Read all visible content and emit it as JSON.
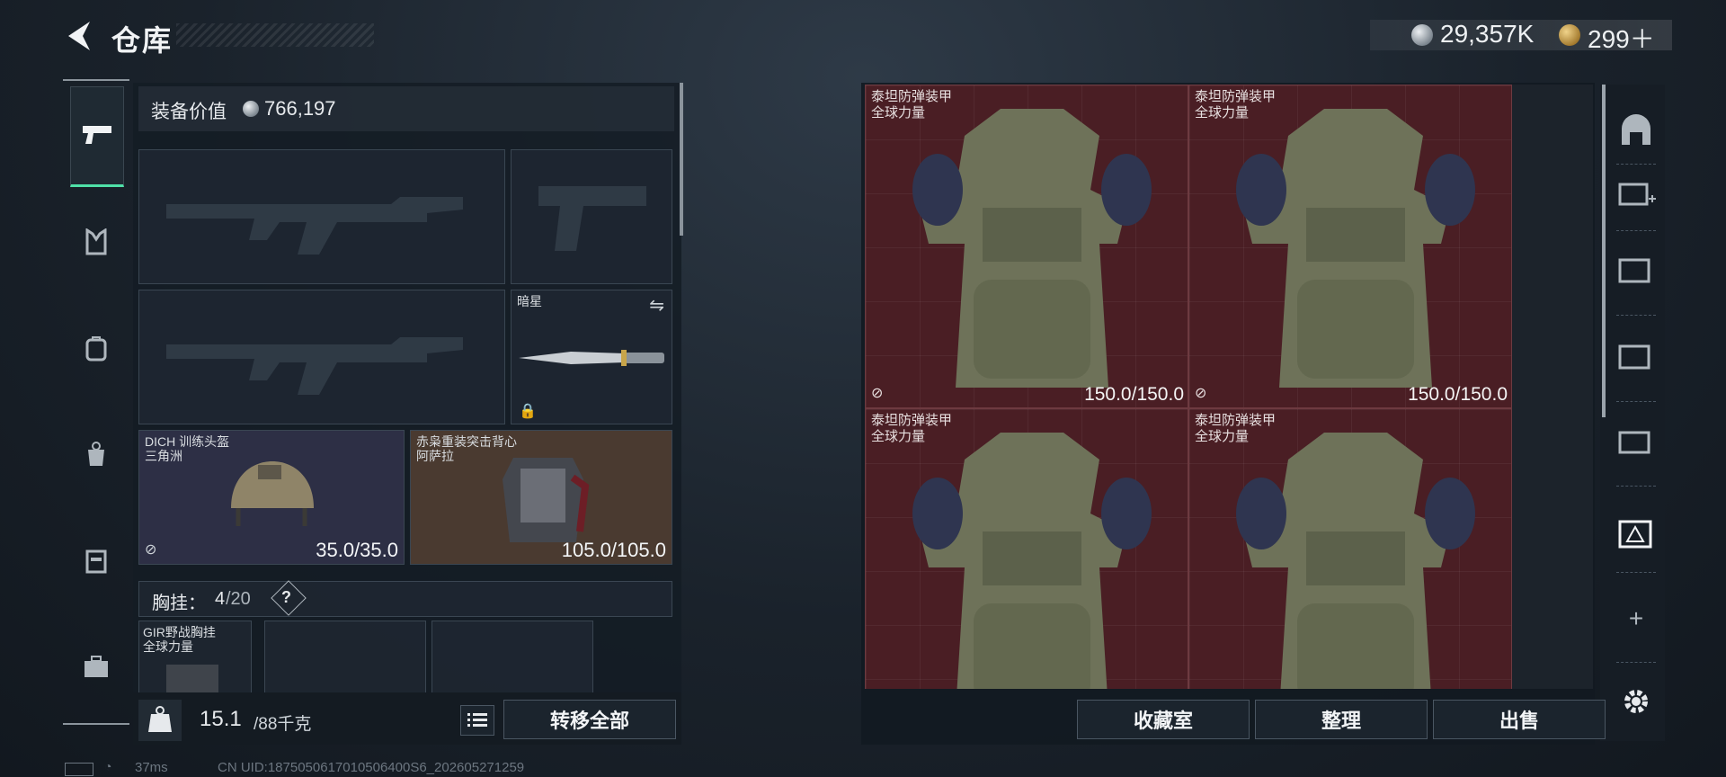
{
  "header": {
    "title": "仓库"
  },
  "currency": {
    "silver": "29,357K",
    "gold": "299＋"
  },
  "left_rail": [
    "pistol-icon",
    "vest-icon",
    "backpack-icon",
    "bag-icon",
    "case-icon",
    "toolbox-icon"
  ],
  "loadout": {
    "value_label": "装备价值",
    "value": "766,197",
    "melee": {
      "name": "暗星"
    },
    "helmet": {
      "name": "DICH 训练头盔",
      "maker": "三角洲",
      "durability": "35.0/35.0"
    },
    "armor": {
      "name": "赤枭重装突击背心",
      "maker": "阿萨拉",
      "durability": "105.0/105.0"
    },
    "chest_rig": {
      "label": "胸挂：",
      "count": "4",
      "capacity": "/20",
      "help": "?"
    },
    "rig_item": {
      "name": "GIR野战胸挂",
      "maker": "全球力量"
    },
    "weight": {
      "current": "15.1",
      "max": "/88千克"
    },
    "transfer_all": "转移全部"
  },
  "storage": {
    "items": [
      {
        "name": "泰坦防弹装甲",
        "maker": "全球力量",
        "durability": "150.0/150.0"
      },
      {
        "name": "泰坦防弹装甲",
        "maker": "全球力量",
        "durability": "150.0/150.0"
      },
      {
        "name": "泰坦防弹装甲",
        "maker": "全球力量",
        "durability": ""
      },
      {
        "name": "泰坦防弹装甲",
        "maker": "全球力量",
        "durability": ""
      }
    ],
    "buttons": {
      "collection": "收藏室",
      "organize": "整理",
      "sell": "出售"
    }
  },
  "status": {
    "ping": "37ms",
    "uid": "CN UID:1875050617010506400S6_202605271259"
  },
  "colors": {
    "accent": "#4fe0a8",
    "item_bg": "#4a1e24"
  }
}
